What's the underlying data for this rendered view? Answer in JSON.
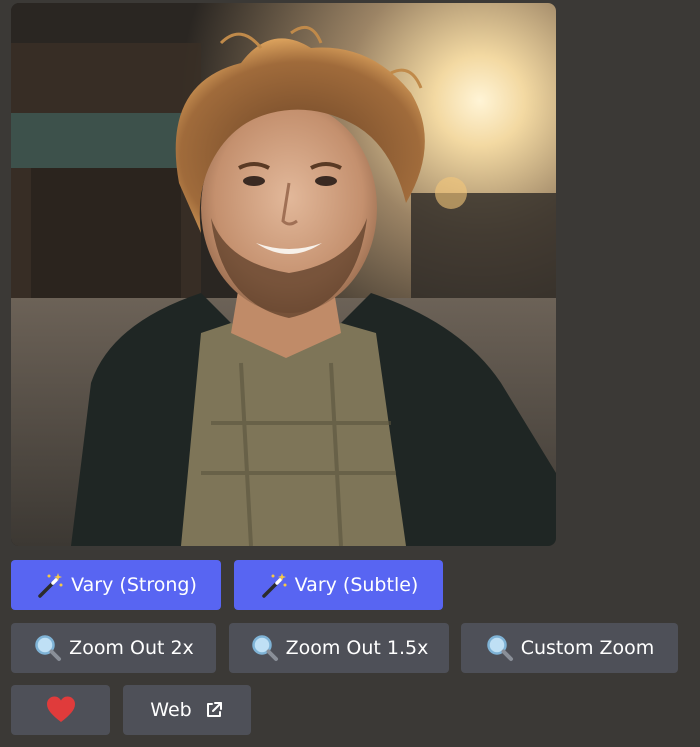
{
  "image": {
    "alt": ""
  },
  "buttons": {
    "row1": [
      {
        "label": "Vary (Strong)",
        "icon": "magic-wand-icon"
      },
      {
        "label": "Vary (Subtle)",
        "icon": "magic-wand-icon"
      }
    ],
    "row2": [
      {
        "label": "Zoom Out 2x",
        "icon": "magnifier-icon"
      },
      {
        "label": "Zoom Out 1.5x",
        "icon": "magnifier-icon"
      },
      {
        "label": "Custom Zoom",
        "icon": "magnifier-icon"
      }
    ],
    "row3": [
      {
        "label": "",
        "icon": "heart-icon"
      },
      {
        "label": "Web",
        "icon": "external-link-icon"
      }
    ]
  },
  "colors": {
    "background": "#3b3936",
    "primary": "#5865f2",
    "secondary": "#4e5058",
    "heart": "#e03b3b"
  }
}
